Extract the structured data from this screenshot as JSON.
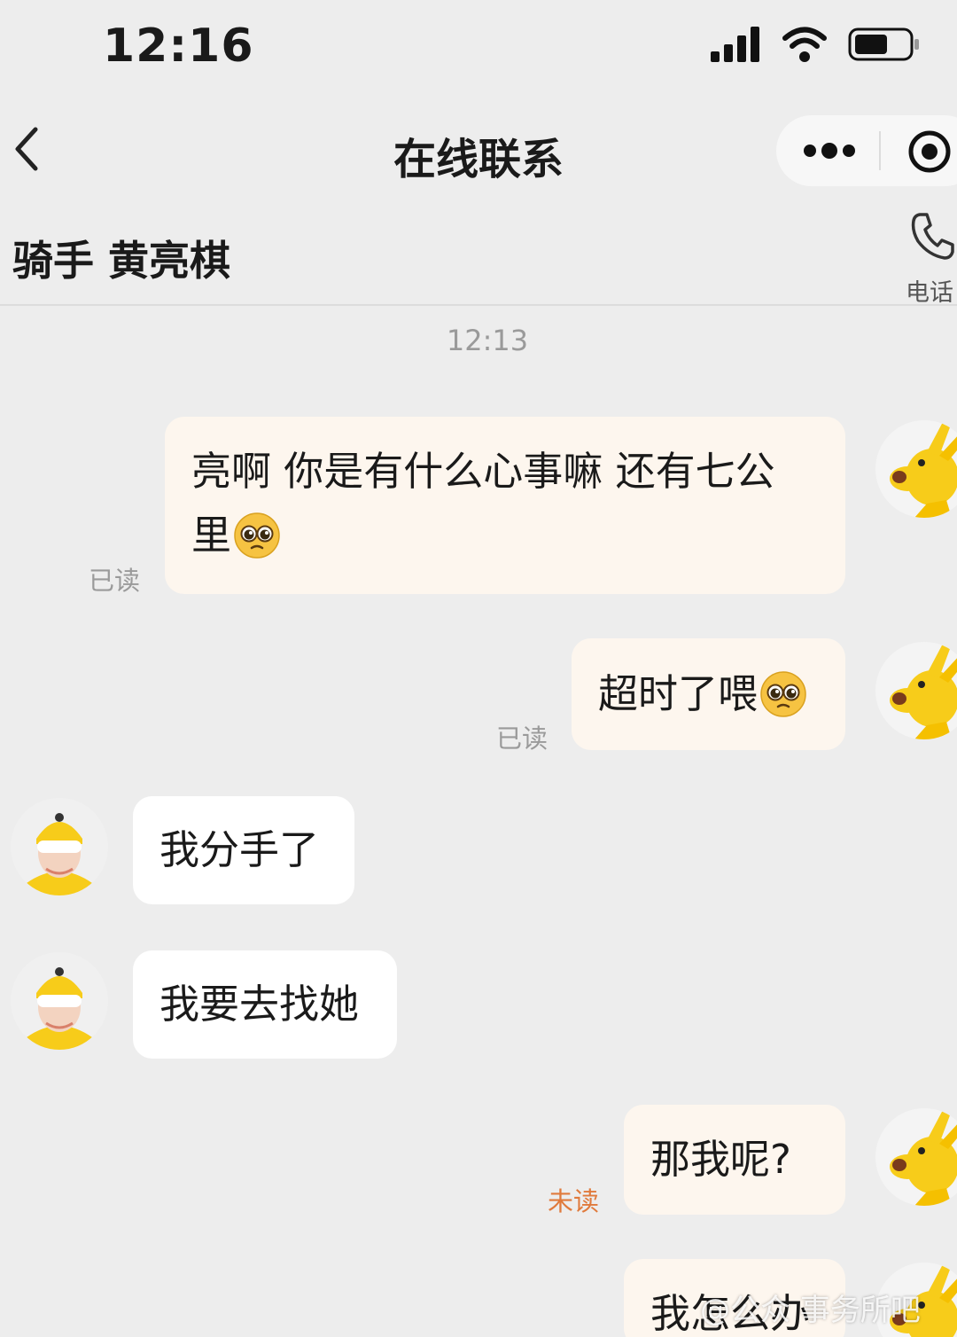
{
  "status_bar": {
    "time": "12:16"
  },
  "nav": {
    "title": "在线联系"
  },
  "header": {
    "rider_name": "骑手 黄亮棋",
    "phone_label": "电话"
  },
  "chat": {
    "timestamp": "12:13",
    "messages": [
      {
        "side": "out",
        "text": "亮啊 你是有什么心事嘛 还有七公",
        "text2": "里",
        "emoji": "pleading-face",
        "status": "已读"
      },
      {
        "side": "out",
        "text": "超时了喂",
        "emoji": "pleading-face",
        "status": "已读"
      },
      {
        "side": "in",
        "text": "我分手了"
      },
      {
        "side": "in",
        "text": "我要去找她"
      },
      {
        "side": "out",
        "text": "那我呢?",
        "status": "未读"
      },
      {
        "side": "out",
        "text": "我怎么办"
      }
    ]
  },
  "watermark": {
    "text": "@公众 事务所吧"
  },
  "colors": {
    "background": "#ededed",
    "outgoing_bubble": "#fdf6ee",
    "incoming_bubble": "#ffffff",
    "unread": "#e07a3c"
  }
}
